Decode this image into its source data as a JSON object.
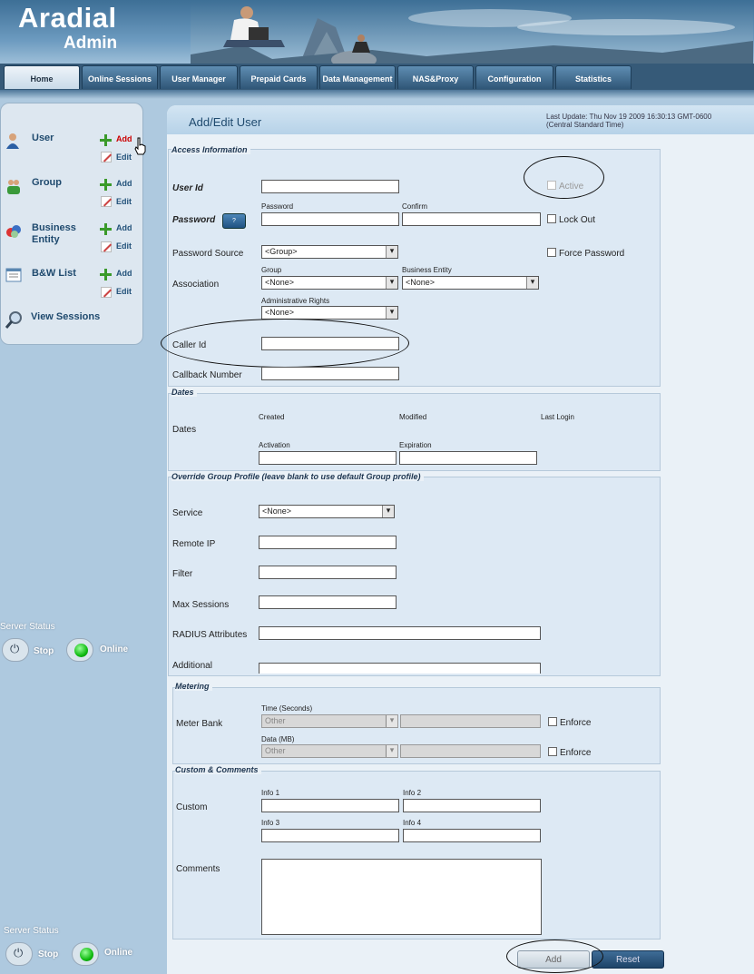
{
  "app": {
    "logo_main": "Aradial",
    "logo_sub": "Admin"
  },
  "tabs": [
    {
      "label": "Home"
    },
    {
      "label": "Online Sessions"
    },
    {
      "label": "User Manager"
    },
    {
      "label": "Prepaid Cards"
    },
    {
      "label": "Data Management"
    },
    {
      "label": "NAS&Proxy"
    },
    {
      "label": "Configuration"
    },
    {
      "label": "Statistics"
    }
  ],
  "sidebar": {
    "items": [
      {
        "label": "User",
        "add": "Add",
        "edit": "Edit"
      },
      {
        "label": "Group",
        "add": "Add",
        "edit": "Edit"
      },
      {
        "label": "Business Entity",
        "add": "Add",
        "edit": "Edit"
      },
      {
        "label": "B&W List",
        "add": "Add",
        "edit": "Edit"
      }
    ],
    "view_sessions": "View Sessions"
  },
  "server_status": {
    "label": "Server Status",
    "stop": "Stop",
    "online": "Online"
  },
  "page": {
    "title": "Add/Edit User",
    "last_update_line1": "Last Update: Thu Nov 19 2009 16:30:13 GMT-0600",
    "last_update_line2": "(Central Standard Time)"
  },
  "access": {
    "section": "Access Information",
    "user_id": "User Id",
    "active": "Active",
    "password": "Password",
    "password_small": "Password",
    "confirm": "Confirm",
    "qbtn": "?",
    "lock_out": "Lock Out",
    "password_source": "Password Source",
    "password_source_value": "<Group>",
    "force_password": "Force Password",
    "association": "Association",
    "group": "Group",
    "group_value": "<None>",
    "business_entity": "Business Entity",
    "business_entity_value": "<None>",
    "admin_rights": "Administrative Rights",
    "admin_rights_value": "<None>",
    "caller_id": "Caller Id",
    "callback_number": "Callback Number"
  },
  "dates": {
    "section": "Dates",
    "label": "Dates",
    "created": "Created",
    "modified": "Modified",
    "last_login": "Last Login",
    "activation": "Activation",
    "expiration": "Expiration"
  },
  "override": {
    "section": "Override Group Profile (leave blank to use default Group profile)",
    "service": "Service",
    "service_value": "<None>",
    "remote_ip": "Remote IP",
    "filter": "Filter",
    "max_sessions": "Max Sessions",
    "radius": "RADIUS Attributes",
    "additional": "Additional"
  },
  "metering": {
    "section": "Metering",
    "meter_bank": "Meter Bank",
    "time": "Time (Seconds)",
    "time_value": "Other",
    "data": "Data (MB)",
    "data_value": "Other",
    "enforce": "Enforce"
  },
  "custom": {
    "section": "Custom & Comments",
    "custom": "Custom",
    "info1": "Info 1",
    "info2": "Info 2",
    "info3": "Info 3",
    "info4": "Info 4",
    "comments": "Comments"
  },
  "buttons": {
    "add": "Add",
    "reset": "Reset"
  }
}
